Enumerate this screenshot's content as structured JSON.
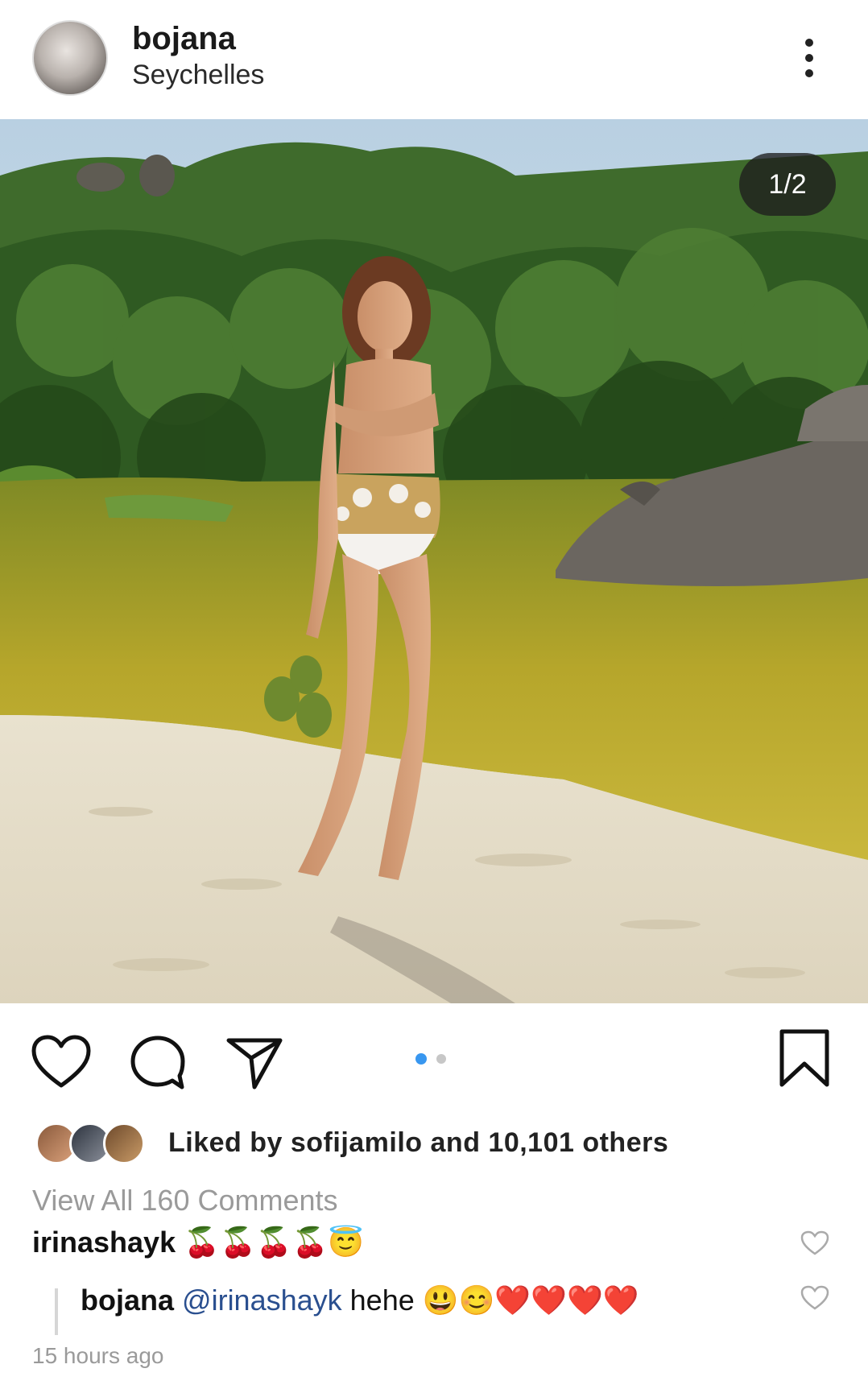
{
  "post": {
    "username": "bojana",
    "location": "Seychelles",
    "image_counter": "1/2",
    "carousel": {
      "total": 2,
      "active": 1
    },
    "likes_text": "Liked by sofijamilo and 10,101 others",
    "view_all_comments": "View All 160 Comments",
    "time_ago": "15 hours ago"
  },
  "comments": [
    {
      "user": "irinashayk",
      "text": "🍒🍒🍒🍒😇"
    },
    {
      "user": "bojana",
      "mention": "@irinashayk",
      "text": " hehe 😃😊❤️❤️❤️❤️"
    }
  ],
  "colors": {
    "carousel_active": "#3897f0",
    "carousel_inactive": "#c7c7c7",
    "mention": "#2a4f8f",
    "muted": "#9a9a9a"
  },
  "icons": [
    "more-vertical-icon",
    "heart-icon",
    "comment-icon",
    "share-icon",
    "bookmark-icon",
    "small-heart-icon"
  ]
}
